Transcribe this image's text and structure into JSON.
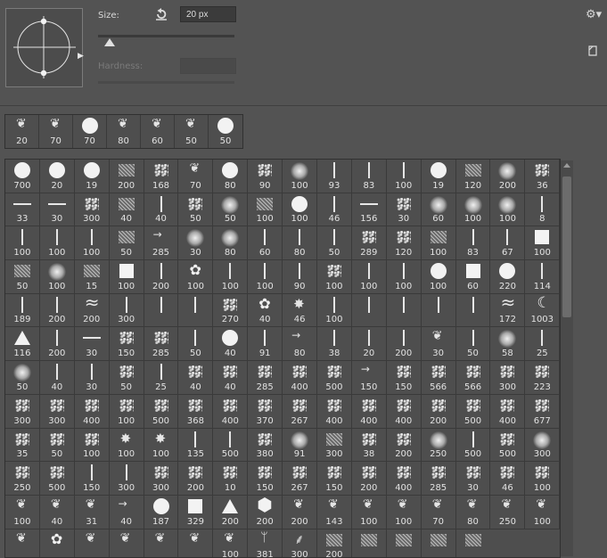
{
  "header": {
    "size_label": "Size:",
    "size_value": "20 px",
    "size_slider_value": 0.08,
    "hardness_label": "Hardness:",
    "hardness_value": ""
  },
  "icons": {
    "brush_tip": "brush-angle-roundness-icon",
    "reset": "reset-icon",
    "gear": "gear-icon",
    "new_preset": "new-preset-icon",
    "scroll_up": "triangle-up-icon"
  },
  "recent_brushes": [
    {
      "icon": "leaf",
      "size": "20"
    },
    {
      "icon": "leaf",
      "size": "70"
    },
    {
      "icon": "dot",
      "size": "70"
    },
    {
      "icon": "leaf",
      "size": "80"
    },
    {
      "icon": "leaf",
      "size": "60"
    },
    {
      "icon": "leaf",
      "size": "50"
    },
    {
      "icon": "dot",
      "size": "50"
    }
  ],
  "brush_grid": [
    [
      "700",
      "20",
      "19",
      "200",
      "168",
      "70",
      "80",
      "90",
      "100",
      "93",
      "83",
      "100",
      "19",
      "120",
      "200",
      "36"
    ],
    [
      "33",
      "30",
      "300",
      "40",
      "40",
      "50",
      "50",
      "100",
      "100",
      "46",
      "156",
      "30",
      "60",
      "100",
      "100",
      "8"
    ],
    [
      "100",
      "100",
      "100",
      "50",
      "285",
      "30",
      "80",
      "60",
      "80",
      "50",
      "289",
      "120",
      "100",
      "83",
      "67"
    ],
    [
      "100",
      "50",
      "100",
      "15",
      "100",
      "200",
      "100",
      "100",
      "100",
      "90",
      "100",
      "100",
      "100",
      "100",
      "60",
      "220"
    ],
    [
      "114",
      "189",
      "200",
      "200",
      "300",
      "",
      "",
      "270",
      "40",
      "46",
      "100",
      "",
      "",
      "",
      "",
      "172"
    ],
    [
      "1003",
      "116",
      "200",
      "30",
      "150",
      "285",
      "50",
      "40",
      "91",
      "80",
      "38",
      "20",
      "200",
      "30",
      "50"
    ],
    [
      "58",
      "25",
      "50",
      "40",
      "30",
      "50",
      "25",
      "40",
      "40",
      "285",
      "400",
      "500",
      "150",
      "150",
      "566",
      "566"
    ],
    [
      "300",
      "223",
      "300",
      "300",
      "400",
      "100",
      "500",
      "368",
      "400",
      "370",
      "267",
      "400",
      "400",
      "400",
      "200",
      "500"
    ],
    [
      "400",
      "677",
      "35",
      "50",
      "100",
      "100",
      "100",
      "135",
      "500",
      "380",
      "91",
      "300",
      "38",
      "200",
      "250",
      "500"
    ],
    [
      "500",
      "300",
      "250",
      "500",
      "150",
      "300",
      "300",
      "200",
      "10",
      "150",
      "267",
      "150",
      "200",
      "400",
      "285",
      "30"
    ],
    [
      "46",
      "100",
      "100",
      "40",
      "31",
      "40",
      "187",
      "329",
      "200",
      "200",
      "200",
      "143",
      "100",
      "100",
      "70",
      "80"
    ],
    [
      "250",
      "100",
      "",
      "",
      "",
      "",
      "",
      "",
      "100",
      "381",
      "300",
      "200",
      "",
      "",
      "",
      ""
    ]
  ],
  "grid_icons": [
    "dot",
    "dot",
    "dot",
    "texture",
    "spray",
    "leaf",
    "dot",
    "spray",
    "soft",
    "vline",
    "vline",
    "vline",
    "dot",
    "texture",
    "soft",
    "spray",
    "hline",
    "hline",
    "spray",
    "texture",
    "vline",
    "spray",
    "soft",
    "texture",
    "dot",
    "vline",
    "hline",
    "spray",
    "soft",
    "soft",
    "soft",
    "vline",
    "vline",
    "vline",
    "vline",
    "texture",
    "shape",
    "soft",
    "soft",
    "vline",
    "vline",
    "vline",
    "spray",
    "spray",
    "texture",
    "vline",
    "vline",
    "sq",
    "texture",
    "soft",
    "texture",
    "sq",
    "vline",
    "flower",
    "vline",
    "vline",
    "vline",
    "spray",
    "vline",
    "vline",
    "dot",
    "sq",
    "dot",
    "vline",
    "vline",
    "vline",
    "wave",
    "vline",
    "vline",
    "vline",
    "spray",
    "flower",
    "star",
    "vline",
    "vline",
    "vline",
    "vline",
    "vline",
    "wave",
    "moon",
    "tri",
    "vline",
    "hline",
    "spray",
    "spray",
    "vline",
    "dot",
    "vline",
    "shape",
    "vline",
    "vline",
    "vline",
    "leaf",
    "vline",
    "soft",
    "vline",
    "soft",
    "vline",
    "vline",
    "spray",
    "vline",
    "spray",
    "spray",
    "spray",
    "spray",
    "spray",
    "shape",
    "spray",
    "spray",
    "spray",
    "spray",
    "spray",
    "spray",
    "spray",
    "spray",
    "spray",
    "spray",
    "spray",
    "spray",
    "spray",
    "spray",
    "spray",
    "spray",
    "spray",
    "spray",
    "spray",
    "spray",
    "spray",
    "spray",
    "spray",
    "spray",
    "star",
    "star",
    "vline",
    "vline",
    "spray",
    "soft",
    "texture",
    "spray",
    "spray",
    "soft",
    "vline",
    "spray",
    "soft",
    "spray",
    "spray",
    "vline",
    "vline",
    "spray",
    "spray",
    "spray",
    "spray",
    "spray",
    "spray",
    "spray",
    "spray",
    "spray",
    "spray",
    "spray",
    "spray",
    "leaf",
    "leaf",
    "leaf",
    "shape",
    "dot",
    "sq",
    "tri",
    "hex",
    "leaf",
    "leaf",
    "leaf",
    "leaf",
    "leaf",
    "leaf",
    "leaf",
    "leaf",
    "leaf",
    "flower",
    "leaf",
    "leaf",
    "leaf",
    "leaf",
    "leaf",
    "grass",
    "tree",
    "texture",
    "texture",
    "texture",
    "texture",
    "texture",
    "texture",
    "texture",
    "texture",
    "texture",
    "bar",
    "bar",
    "bar",
    "leaf",
    "texture"
  ]
}
